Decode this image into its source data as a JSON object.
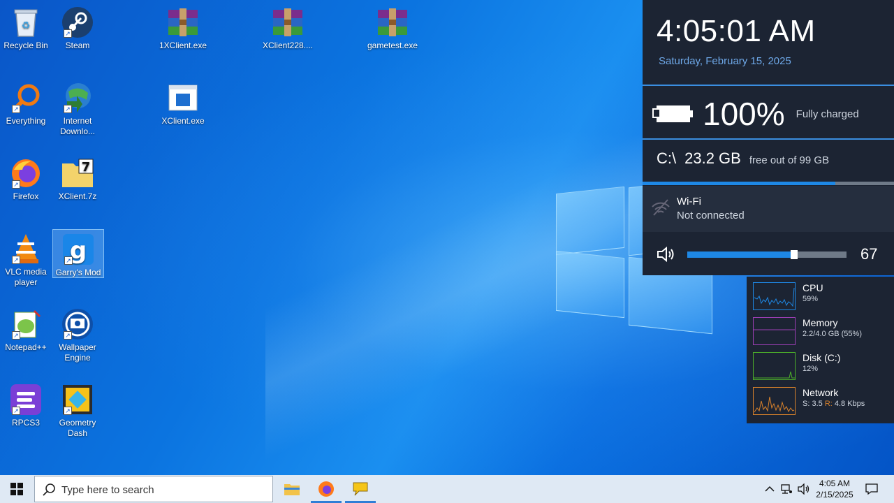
{
  "desktop": {
    "icons": [
      {
        "label": "Recycle Bin",
        "icon": "recycle-bin-icon"
      },
      {
        "label": "Steam",
        "icon": "steam-icon"
      },
      {
        "label": "1XClient.exe",
        "icon": "winrar-archive-icon"
      },
      {
        "label": "XClient228....",
        "icon": "winrar-archive-icon"
      },
      {
        "label": "gametest.exe",
        "icon": "winrar-archive-icon"
      },
      {
        "label": "Everything",
        "icon": "everything-search-icon"
      },
      {
        "label": "Internet Downlo...",
        "icon": "internet-download-manager-icon"
      },
      {
        "label": "XClient.exe",
        "icon": "executable-icon"
      },
      {
        "label": "Firefox",
        "icon": "firefox-icon"
      },
      {
        "label": "XClient.7z",
        "icon": "7zip-archive-icon"
      },
      {
        "label": "VLC media player",
        "icon": "vlc-icon"
      },
      {
        "label": "Garry's Mod",
        "icon": "garrys-mod-icon"
      },
      {
        "label": "Notepad++",
        "icon": "notepad-plus-plus-icon"
      },
      {
        "label": "Wallpaper Engine",
        "icon": "wallpaper-engine-icon"
      },
      {
        "label": "RPCS3",
        "icon": "rpcs3-icon"
      },
      {
        "label": "Geometry Dash",
        "icon": "geometry-dash-icon"
      }
    ]
  },
  "panel": {
    "time": "4:05:01 AM",
    "date": "Saturday, February 15, 2025",
    "battery": {
      "percent": "100%",
      "status": "Fully charged",
      "level": 1.0
    },
    "disk": {
      "drive": "C:\\",
      "free": "23.2 GB",
      "total_text": "free out of 99 GB",
      "used_fraction": 0.766
    },
    "wifi": {
      "name": "Wi-Fi",
      "status": "Not connected"
    },
    "volume": {
      "value": "67",
      "level": 0.67
    }
  },
  "perf": {
    "cpu": {
      "title": "CPU",
      "value": "59%",
      "color": "#1e88e5"
    },
    "memory": {
      "title": "Memory",
      "value": "2.2/4.0 GB (55%)",
      "color": "#9c3fb5"
    },
    "disk": {
      "title": "Disk (C:)",
      "value": "12%",
      "color": "#4caf2a"
    },
    "network": {
      "title": "Network",
      "value_s": "S: 3.5",
      "value_r_label": "R:",
      "value_r": "4.8 Kbps",
      "color": "#d9822b"
    }
  },
  "taskbar": {
    "search_placeholder": "Type here to search",
    "time": "4:05 AM",
    "date": "2/15/2025",
    "apps": [
      "file-explorer-icon",
      "firefox-icon",
      "messages-app-icon"
    ],
    "accent": "#2f7ed6"
  }
}
